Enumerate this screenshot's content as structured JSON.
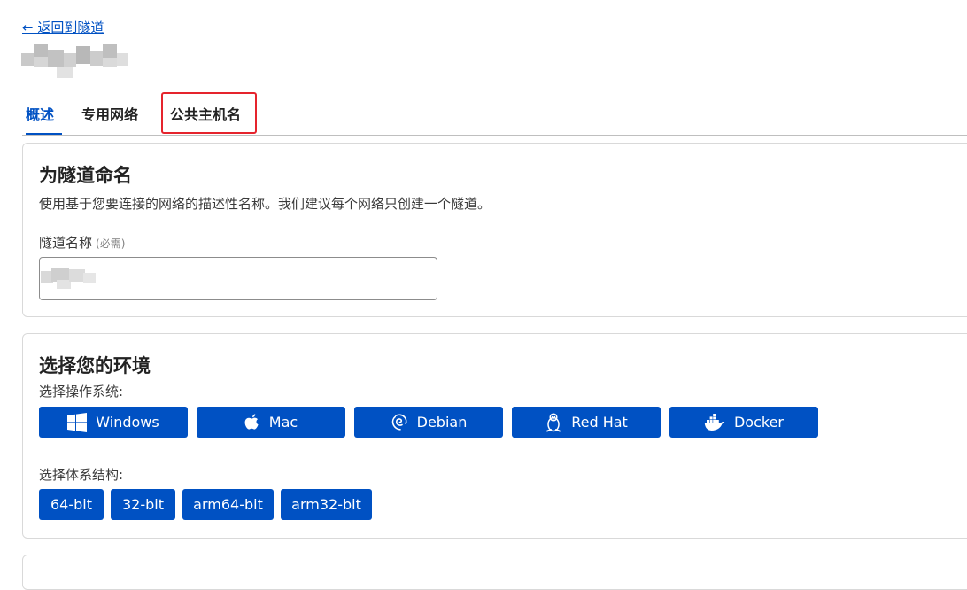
{
  "nav": {
    "back_label": "← 返回到隧道"
  },
  "tabs": [
    {
      "label": "概述",
      "active": true
    },
    {
      "label": "专用网络",
      "active": false
    },
    {
      "label": "公共主机名",
      "active": false,
      "highlighted": true
    }
  ],
  "name_card": {
    "title": "为隧道命名",
    "description": "使用基于您要连接的网络的描述性名称。我们建议每个网络只创建一个隧道。",
    "field_label": "隧道名称",
    "required_hint": "(必需)",
    "input_value": ""
  },
  "env_card": {
    "title": "选择您的环境",
    "os_label": "选择操作系统:",
    "os_options": [
      {
        "label": "Windows",
        "icon": "windows-icon"
      },
      {
        "label": "Mac",
        "icon": "apple-icon"
      },
      {
        "label": "Debian",
        "icon": "debian-icon"
      },
      {
        "label": "Red Hat",
        "icon": "linux-tux-icon"
      },
      {
        "label": "Docker",
        "icon": "docker-icon"
      }
    ],
    "arch_label": "选择体系结构:",
    "arch_options": [
      "64-bit",
      "32-bit",
      "arm64-bit",
      "arm32-bit"
    ]
  },
  "colors": {
    "accent": "#0051c3",
    "highlight": "#e5242d",
    "border": "#d9d9d9"
  }
}
